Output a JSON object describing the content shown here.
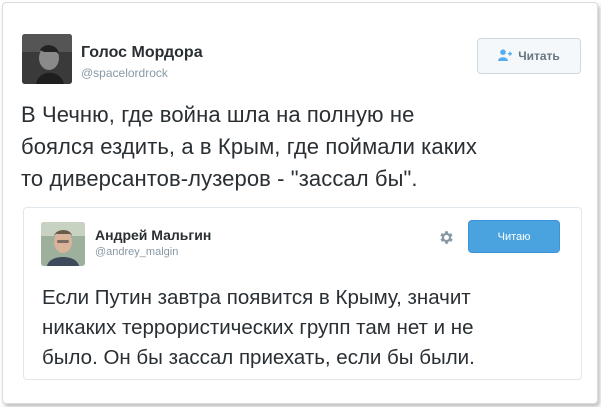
{
  "outer_tweet": {
    "author_name": "Голос Мордора",
    "author_handle": "@spacelordrock",
    "follow_label": "Читать",
    "follow_icon": "person-plus-icon",
    "text_lines": [
      "В Чечню, где война шла на полную не",
      "боялся ездить, а в Крым, где поймали каких",
      "то диверсантов-лузеров - \"зассал бы\"."
    ]
  },
  "quoted_tweet": {
    "author_name": "Андрей Мальгин",
    "author_handle": "@andrey_malgin",
    "settings_icon": "gear-icon",
    "following_label": "Читаю",
    "text_lines": [
      "Если Путин завтра появится в Крыму, значит",
      "никаких террористических групп там нет и не",
      "было. Он бы зассал приехать, если бы были."
    ]
  },
  "colors": {
    "accent": "#55acee",
    "text": "#292f33",
    "muted": "#8899a6",
    "following_bg": "#4aa3df"
  }
}
